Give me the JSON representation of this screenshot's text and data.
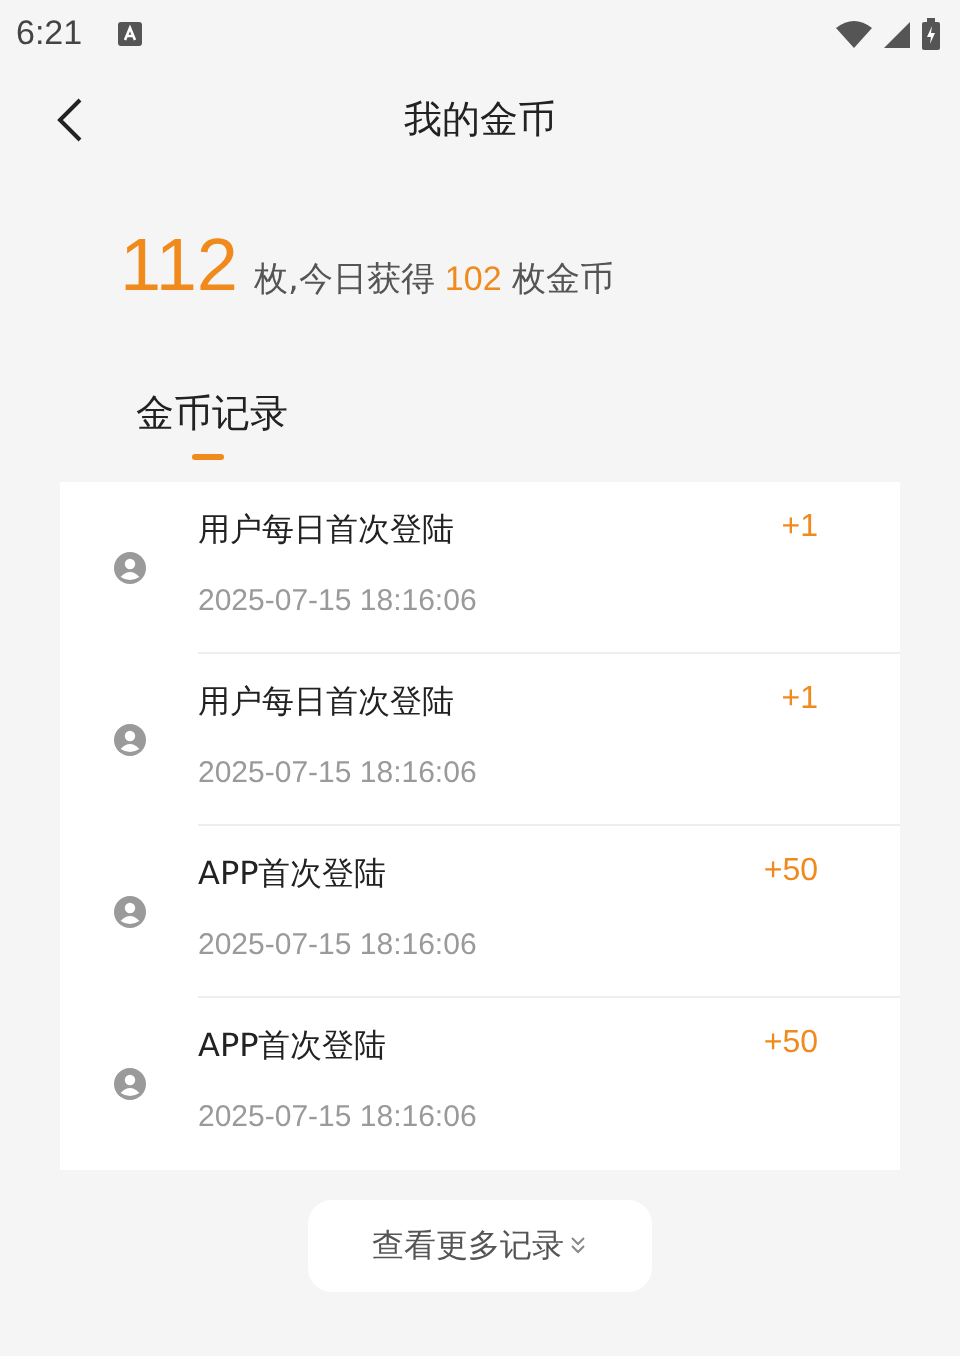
{
  "status_bar": {
    "time": "6:21"
  },
  "header": {
    "title": "我的金币"
  },
  "summary": {
    "total": "112",
    "text_1": "枚,今日获得",
    "today": "102",
    "text_2": "枚金币"
  },
  "tabs": [
    {
      "label": "金币记录",
      "selected": true
    }
  ],
  "records": [
    {
      "title": "用户每日首次登陆",
      "amount": "+1",
      "time": "2025-07-15 18:16:06"
    },
    {
      "title": "用户每日首次登陆",
      "amount": "+1",
      "time": "2025-07-15 18:16:06"
    },
    {
      "title": "APP首次登陆",
      "amount": "+50",
      "time": "2025-07-15 18:16:06"
    },
    {
      "title": "APP首次登陆",
      "amount": "+50",
      "time": "2025-07-15 18:16:06"
    }
  ],
  "more_button": {
    "label": "查看更多记录"
  }
}
